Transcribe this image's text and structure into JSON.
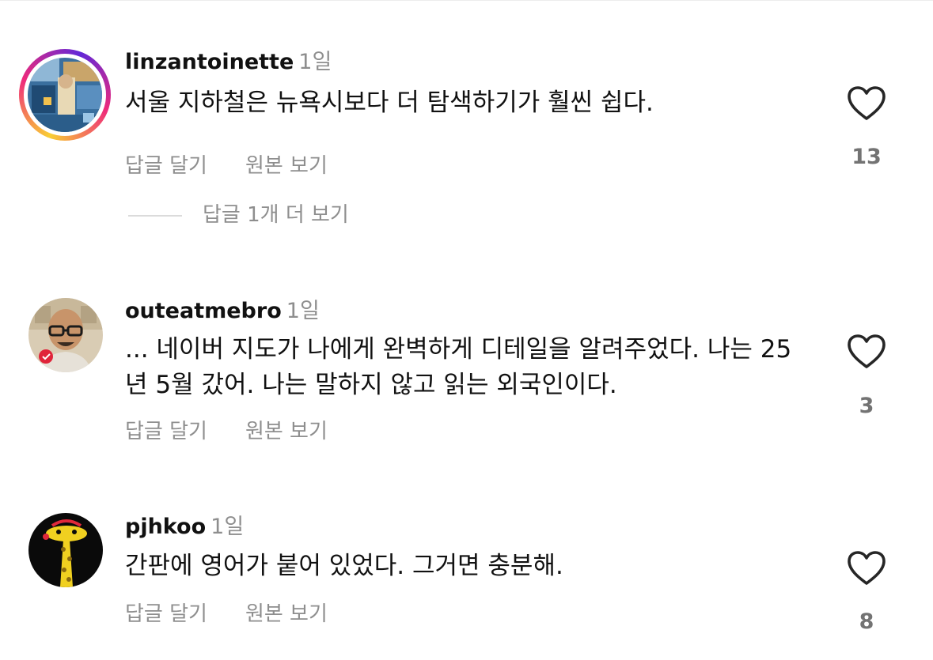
{
  "actions": {
    "reply": "답글 달기",
    "see_original": "원본 보기"
  },
  "comments": [
    {
      "username": "linzantoinette",
      "time": "1일",
      "text": "서울 지하철은 뉴욕시보다 더 탐색하기가 훨씬 쉽다.",
      "likes": "13",
      "view_replies": "답글 1개 더 보기",
      "avatar_icon": "collage-avatar",
      "story_ring": true
    },
    {
      "username": "outeatmebro",
      "time": "1일",
      "text": "... 네이버 지도가 나에게 완벽하게 디테일을 알려주었다. 나는 25년 5월 갔어. 나는 말하지 않고 읽는 외국인이다.",
      "likes": "3",
      "avatar_icon": "man-with-glasses-avatar",
      "story_ring": false
    },
    {
      "username": "pjhkoo",
      "time": "1일",
      "text": "간판에 영어가 붙어 있었다. 그거면 충분해.",
      "likes": "8",
      "avatar_icon": "giraffe-avatar",
      "story_ring": false
    }
  ],
  "colors": {
    "secondary_text": "#8e8e8e",
    "primary_text": "#111111",
    "heart_outline": "#262626"
  }
}
